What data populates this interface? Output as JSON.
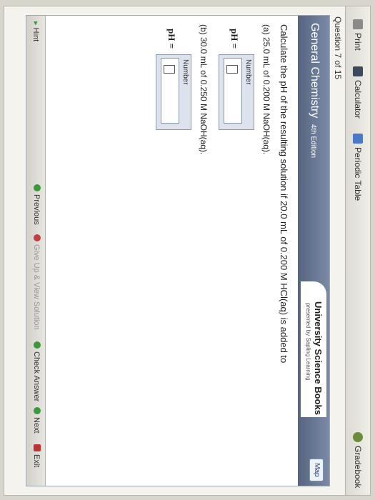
{
  "toolbar": {
    "print_label": "Print",
    "calculator_label": "Calculator",
    "periodic_table_label": "Periodic Table",
    "gradebook_label": "Gradebook"
  },
  "question_count": "Question 7 of 15",
  "banner": {
    "course_title": "General Chemistry",
    "edition": "4th Edition",
    "publisher": "University Science Books",
    "publisher_sub": "presented by Sapling Learning",
    "map_label": "Map"
  },
  "question": {
    "prompt": "Calculate the pH of the resulting solution if 20.0 mL of 0.200 M HCl(aq) is added to",
    "parts": [
      {
        "label": "(a) 25.0 mL of 0.200 M NaOH(aq).",
        "ph_label": "pH =",
        "field_label": "Number",
        "value": ""
      },
      {
        "label": "(b) 30.0 mL of 0.250 M NaOH(aq).",
        "ph_label": "pH =",
        "field_label": "Number",
        "value": ""
      }
    ]
  },
  "footer": {
    "hint_label": "Hint",
    "previous_label": "Previous",
    "give_up_label": "Give Up & View Solution",
    "check_answer_label": "Check Answer",
    "next_label": "Next",
    "exit_label": "Exit"
  },
  "colors": {
    "banner": "#5d6c88",
    "accent_green": "#3a9a3a"
  }
}
